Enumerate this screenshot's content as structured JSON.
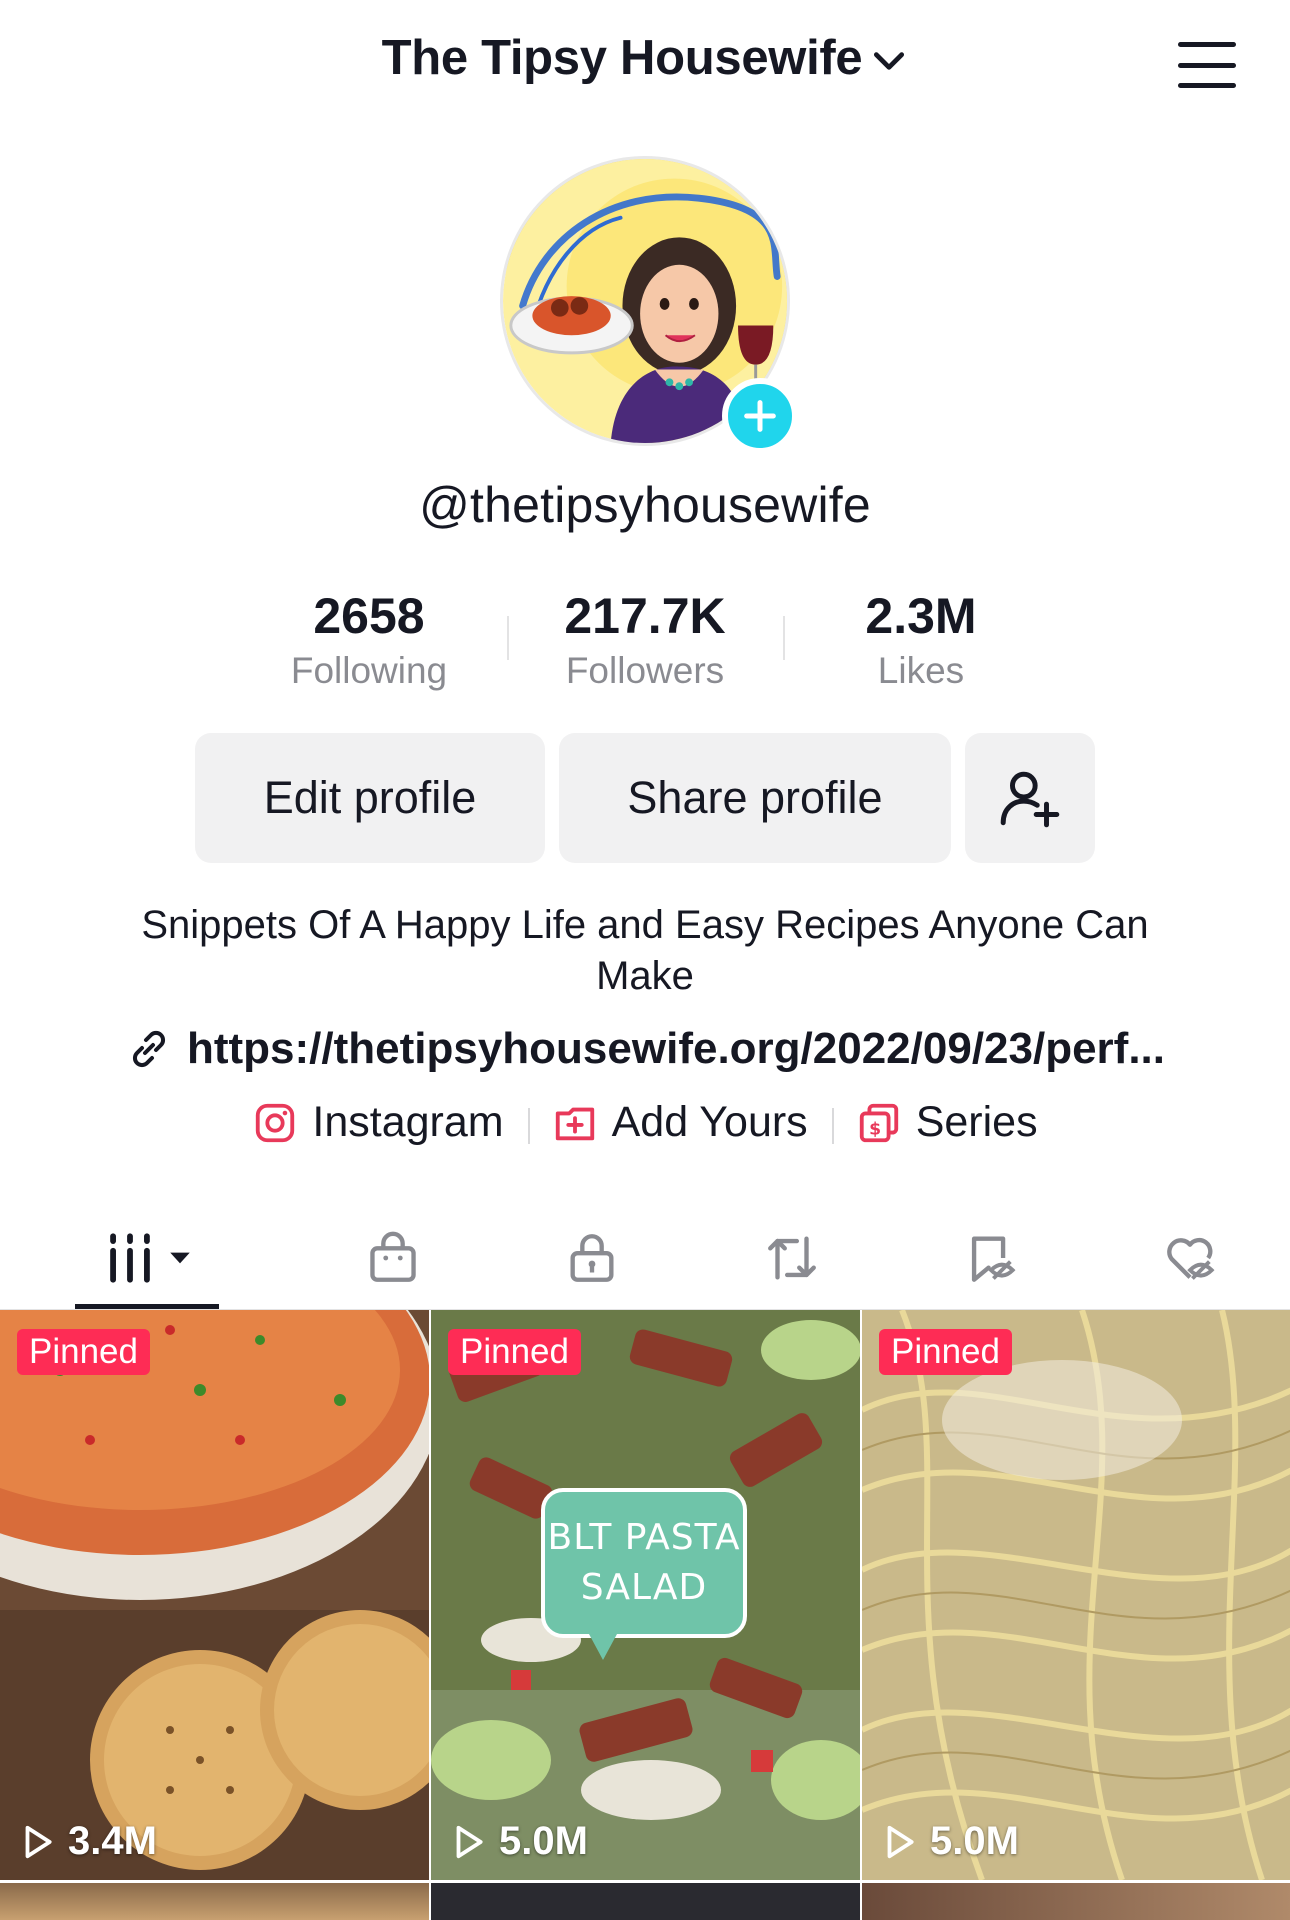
{
  "header": {
    "account_name": "The Tipsy Housewife"
  },
  "profile": {
    "username": "@thetipsyhousewife",
    "stats": [
      {
        "value": "2658",
        "label": "Following"
      },
      {
        "value": "217.7K",
        "label": "Followers"
      },
      {
        "value": "2.3M",
        "label": "Likes"
      }
    ],
    "bio": "Snippets Of A Happy Life and Easy Recipes Anyone Can Make",
    "link": "https://thetipsyhousewife.org/2022/09/23/perf...",
    "social": [
      {
        "label": "Instagram",
        "icon": "instagram-icon"
      },
      {
        "label": "Add Yours",
        "icon": "add-yours-icon"
      },
      {
        "label": "Series",
        "icon": "series-icon"
      }
    ]
  },
  "buttons": {
    "edit": "Edit profile",
    "share": "Share profile"
  },
  "tabs": [
    {
      "icon": "videos-grid-icon",
      "active": true
    },
    {
      "icon": "shop-bag-icon"
    },
    {
      "icon": "private-lock-icon"
    },
    {
      "icon": "reposts-icon"
    },
    {
      "icon": "favorites-hidden-icon"
    },
    {
      "icon": "liked-hidden-icon"
    }
  ],
  "videos": [
    {
      "pinned_label": "Pinned",
      "views": "3.4M"
    },
    {
      "pinned_label": "Pinned",
      "views": "5.0M",
      "sticker": [
        "BLT PASTA",
        "SALAD"
      ]
    },
    {
      "pinned_label": "Pinned",
      "views": "5.0M"
    }
  ],
  "colors": {
    "accent": "#fe2c55",
    "follow_plus": "#20d5ec",
    "button_bg": "#f1f1f2",
    "text": "#161823",
    "muted": "#8a8b91"
  }
}
